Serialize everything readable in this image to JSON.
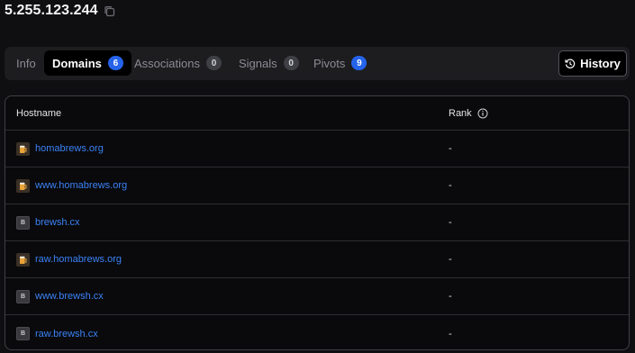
{
  "header": {
    "ip": "5.255.123.244"
  },
  "tabs": [
    {
      "label": "Info",
      "count": null
    },
    {
      "label": "Domains",
      "count": "6"
    },
    {
      "label": "Associations",
      "count": "0"
    },
    {
      "label": "Signals",
      "count": "0"
    },
    {
      "label": "Pivots",
      "count": "9"
    }
  ],
  "history_label": "History",
  "table": {
    "columns": [
      "Hostname",
      "Rank"
    ],
    "rows": [
      {
        "hostname": "homabrews.org",
        "rank": "-",
        "icon": "beer-mug-icon"
      },
      {
        "hostname": "www.homabrews.org",
        "rank": "-",
        "icon": "beer-mug-icon"
      },
      {
        "hostname": "brewsh.cx",
        "rank": "-",
        "icon": "letter-b-icon"
      },
      {
        "hostname": "raw.homabrews.org",
        "rank": "-",
        "icon": "beer-mug-icon"
      },
      {
        "hostname": "www.brewsh.cx",
        "rank": "-",
        "icon": "letter-b-icon"
      },
      {
        "hostname": "raw.brewsh.cx",
        "rank": "-",
        "icon": "letter-b-icon"
      }
    ]
  },
  "favicon_letter": "B",
  "colors": {
    "accent": "#2563eb",
    "link": "#3b82f6",
    "background": "#0f0f11"
  }
}
